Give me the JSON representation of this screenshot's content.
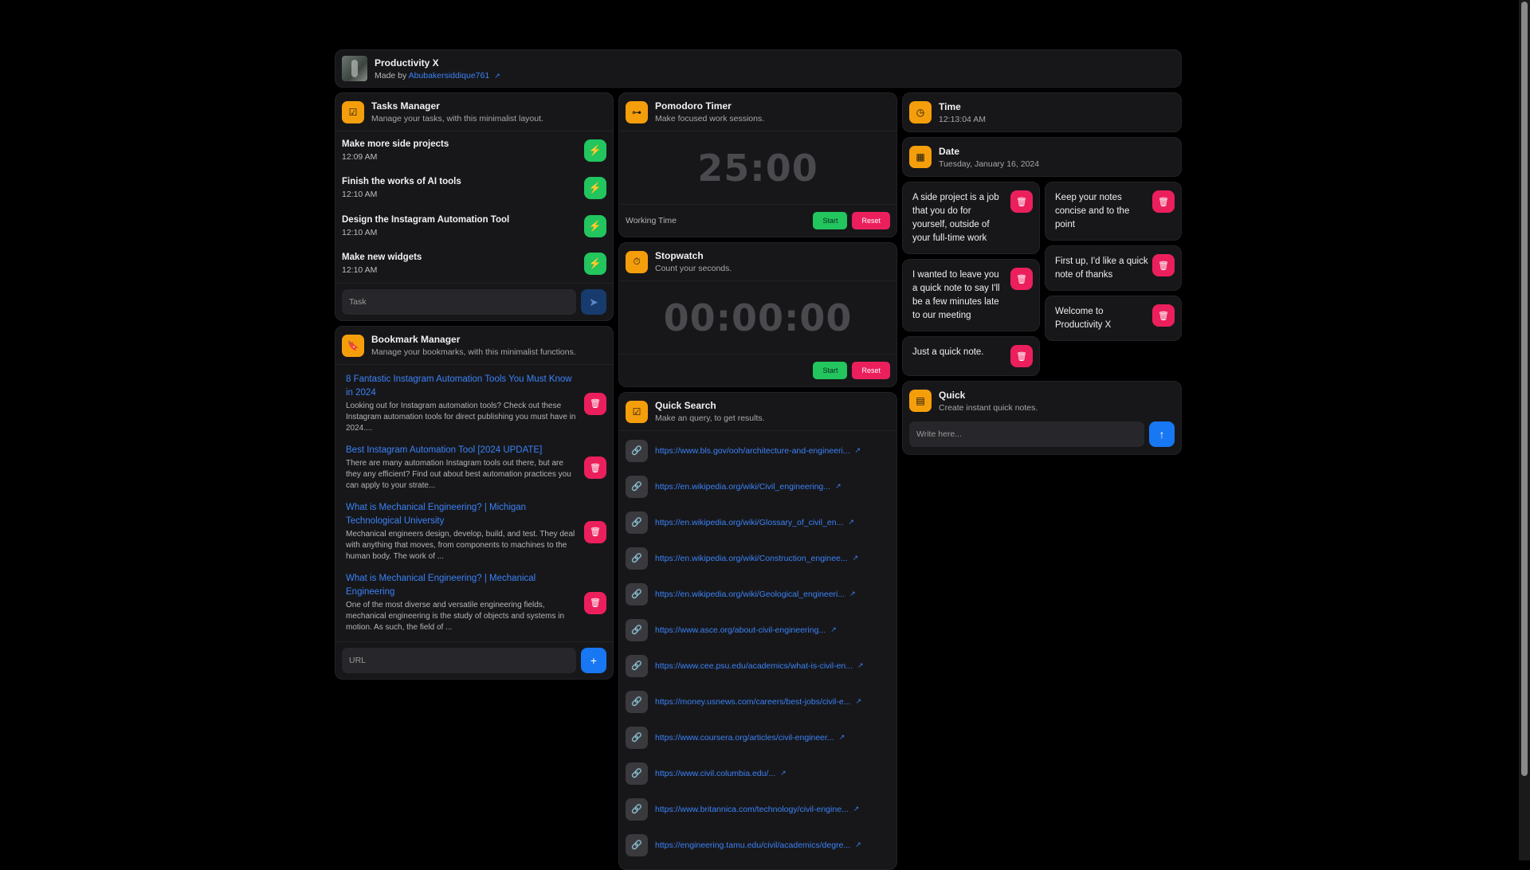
{
  "header": {
    "title": "Productivity X",
    "made_by": "Made by",
    "author": "Abubakersiddique761"
  },
  "tasks": {
    "title": "Tasks Manager",
    "subtitle": "Manage your tasks, with this minimalist layout.",
    "items": [
      {
        "name": "Make more side projects",
        "time": "12:09 AM"
      },
      {
        "name": "Finish the works of AI tools",
        "time": "12:10 AM"
      },
      {
        "name": "Design the Instagram Automation Tool",
        "time": "12:10 AM"
      },
      {
        "name": "Make new widgets",
        "time": "12:10 AM"
      }
    ],
    "input_placeholder": "Task"
  },
  "bookmarks": {
    "title": "Bookmark Manager",
    "subtitle": "Manage your bookmarks, with this minimalist functions.",
    "items": [
      {
        "title": "8 Fantastic Instagram Automation Tools You Must Know in 2024",
        "desc": "Looking out for Instagram automation tools? Check out these Instagram automation tools for direct publishing you must have in 2024...."
      },
      {
        "title": "Best Instagram Automation Tool [2024 UPDATE]",
        "desc": "There are many automation Instagram tools out there, but are they any efficient? Find out about best automation practices you can apply to your strate..."
      },
      {
        "title": "What is Mechanical Engineering? | Michigan Technological University",
        "desc": "Mechanical engineers design, develop, build, and test. They deal with anything that moves, from components to machines to the human body. The work of ..."
      },
      {
        "title": "What is Mechanical Engineering? | Mechanical Engineering",
        "desc": "One of the most diverse and versatile engineering fields, mechanical engineering is the study of objects and systems in motion. As such, the field of ..."
      }
    ],
    "input_placeholder": "URL"
  },
  "pomodoro": {
    "title": "Pomodoro Timer",
    "subtitle": "Make focused work sessions.",
    "time": "25:00",
    "label": "Working Time",
    "start": "Start",
    "reset": "Reset"
  },
  "stopwatch": {
    "title": "Stopwatch",
    "subtitle": "Count your seconds.",
    "time": "00:00:00",
    "start": "Start",
    "reset": "Reset"
  },
  "search": {
    "title": "Quick Search",
    "subtitle": "Make an query, to get results.",
    "links": [
      "https://www.bls.gov/ooh/architecture-and-engineeri...",
      "https://en.wikipedia.org/wiki/Civil_engineering...",
      "https://en.wikipedia.org/wiki/Glossary_of_civil_en...",
      "https://en.wikipedia.org/wiki/Construction_enginee...",
      "https://en.wikipedia.org/wiki/Geological_engineeri...",
      "https://www.asce.org/about-civil-engineering...",
      "https://www.cee.psu.edu/academics/what-is-civil-en...",
      "https://money.usnews.com/careers/best-jobs/civil-e...",
      "https://www.coursera.org/articles/civil-engineer...",
      "https://www.civil.columbia.edu/...",
      "https://www.britannica.com/technology/civil-engine...",
      "https://engineering.tamu.edu/civil/academics/degre..."
    ]
  },
  "time": {
    "title": "Time",
    "value": "12:13:04 AM"
  },
  "date": {
    "title": "Date",
    "value": "Tuesday, January 16, 2024"
  },
  "notes": {
    "left": [
      "A side project is a job that you do for yourself, outside of your full-time work",
      "I wanted to leave you a quick note to say I'll be a few minutes late to our meeting",
      "Just a quick note."
    ],
    "right": [
      "Keep your notes concise and to the point",
      "First up, I'd like a quick note of thanks",
      "Welcome to Productivity X"
    ]
  },
  "quick": {
    "title": "Quick",
    "subtitle": "Create instant quick notes.",
    "input_placeholder": "Write here..."
  },
  "colors": {
    "accent": "#f59e0b",
    "green": "#22c55e",
    "red": "#ec1f5d",
    "blue": "#1877f2"
  }
}
